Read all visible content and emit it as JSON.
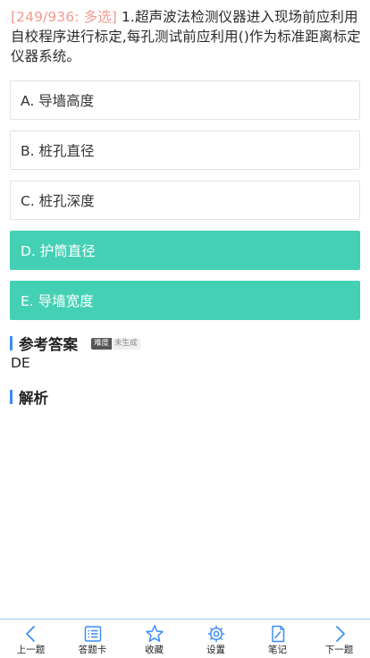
{
  "question": {
    "tag": "[249/936: 多选]",
    "text": " 1.超声波法检测仪器进入现场前应利用自校程序进行标定,每孔测试前应利用()作为标准距离标定仪器系统。"
  },
  "options": [
    {
      "label": "A. 导墙高度",
      "selected": false
    },
    {
      "label": "B. 桩孔直径",
      "selected": false
    },
    {
      "label": "C. 桩孔深度",
      "selected": false
    },
    {
      "label": "D. 护筒直径",
      "selected": true
    },
    {
      "label": "E. 导墙宽度",
      "selected": true
    }
  ],
  "answer_section": {
    "title": "参考答案",
    "difficulty_label": "难度",
    "difficulty_value": "未生成",
    "answer": "DE"
  },
  "analysis_section": {
    "title": "解析"
  },
  "bottom_nav": [
    {
      "label": "上一题",
      "icon": "chevron-left-icon"
    },
    {
      "label": "答题卡",
      "icon": "list-icon"
    },
    {
      "label": "收藏",
      "icon": "star-icon"
    },
    {
      "label": "设置",
      "icon": "gear-icon"
    },
    {
      "label": "笔记",
      "icon": "note-icon"
    },
    {
      "label": "下一题",
      "icon": "chevron-right-icon"
    }
  ],
  "colors": {
    "accent_blue": "#3d8df5",
    "selected_option": "#44d0b5",
    "tag": "#f19b8f"
  }
}
